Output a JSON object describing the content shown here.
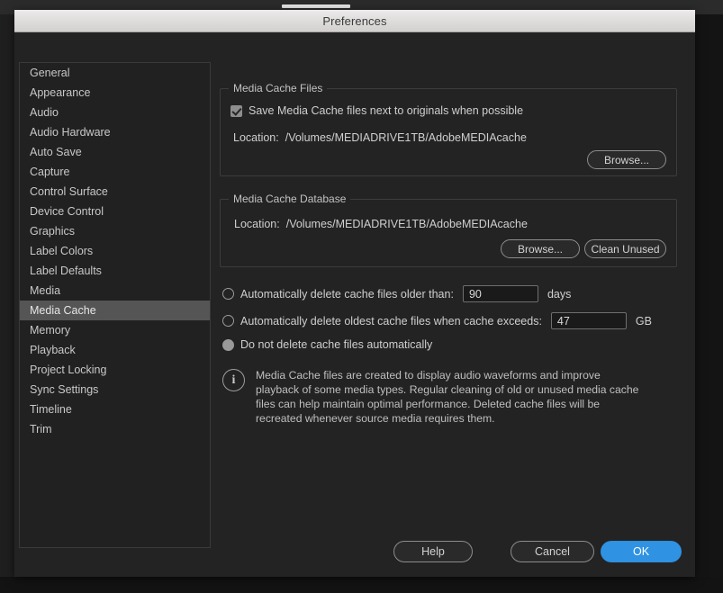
{
  "window": {
    "title": "Preferences"
  },
  "sidebar": {
    "items": [
      {
        "label": "General",
        "selected": false
      },
      {
        "label": "Appearance",
        "selected": false
      },
      {
        "label": "Audio",
        "selected": false
      },
      {
        "label": "Audio Hardware",
        "selected": false
      },
      {
        "label": "Auto Save",
        "selected": false
      },
      {
        "label": "Capture",
        "selected": false
      },
      {
        "label": "Control Surface",
        "selected": false
      },
      {
        "label": "Device Control",
        "selected": false
      },
      {
        "label": "Graphics",
        "selected": false
      },
      {
        "label": "Label Colors",
        "selected": false
      },
      {
        "label": "Label Defaults",
        "selected": false
      },
      {
        "label": "Media",
        "selected": false
      },
      {
        "label": "Media Cache",
        "selected": true
      },
      {
        "label": "Memory",
        "selected": false
      },
      {
        "label": "Playback",
        "selected": false
      },
      {
        "label": "Project Locking",
        "selected": false
      },
      {
        "label": "Sync Settings",
        "selected": false
      },
      {
        "label": "Timeline",
        "selected": false
      },
      {
        "label": "Trim",
        "selected": false
      }
    ]
  },
  "media_cache_files": {
    "group_title": "Media Cache Files",
    "save_next_to_originals": {
      "label": "Save Media Cache files next to originals when possible",
      "checked": true
    },
    "location_label": "Location:",
    "location_path": "/Volumes/MEDIADRIVE1TB/AdobeMEDIAcache",
    "browse_label": "Browse..."
  },
  "media_cache_database": {
    "group_title": "Media Cache Database",
    "location_label": "Location:",
    "location_path": "/Volumes/MEDIADRIVE1TB/AdobeMEDIAcache",
    "browse_label": "Browse...",
    "clean_unused_label": "Clean Unused"
  },
  "cache_policy": {
    "option_older_than": {
      "label": "Automatically delete cache files older than:",
      "selected": false,
      "value": "90",
      "unit": "days"
    },
    "option_exceeds": {
      "label": "Automatically delete oldest cache files when cache exceeds:",
      "selected": false,
      "value": "47",
      "unit": "GB"
    },
    "option_never": {
      "label": "Do not delete cache files automatically",
      "selected": true
    }
  },
  "info": {
    "icon": "info-circle-icon",
    "text": "Media Cache files are created to display audio waveforms and improve playback of some media types.  Regular cleaning of old or unused media cache files can help maintain optimal performance. Deleted cache files will be recreated whenever source media requires them."
  },
  "footer": {
    "help_label": "Help",
    "cancel_label": "Cancel",
    "ok_label": "OK"
  },
  "colors": {
    "accent_blue": "#3092e2",
    "dialog_bg": "#232323",
    "titlebar": "#e0dddd",
    "selected_row": "#555555"
  }
}
